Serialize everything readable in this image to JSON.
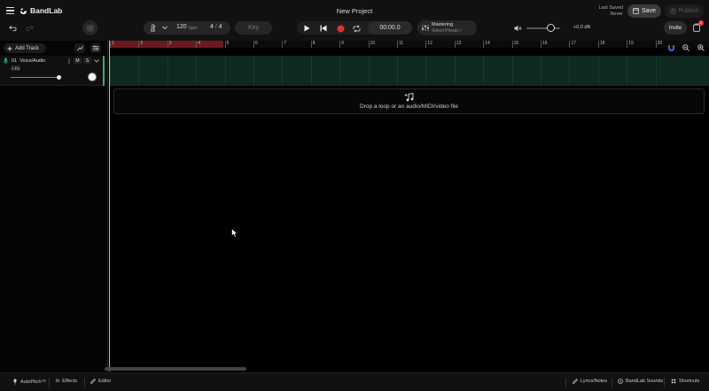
{
  "app": {
    "name": "BandLab",
    "project_title": "New Project"
  },
  "header": {
    "last_saved_label": "Last Saved",
    "last_saved_value": "Never",
    "save_label": "Save",
    "publish_label": "Publish"
  },
  "toolbar": {
    "tempo": "120",
    "tempo_unit": "bpm",
    "time_sig_top": "4",
    "time_sig_sep": "/",
    "time_sig_bottom": "4",
    "key_label": "Key",
    "time_display": "00:00.0",
    "mastering_title": "Mastering",
    "mastering_sub": "Select Preset >",
    "volume_db": "+0.0 dB",
    "volume_level": 0.72,
    "invite_label": "Invite",
    "notification_count": "2"
  },
  "tracks_panel": {
    "add_track_label": "Add Track",
    "tracks": [
      {
        "number": "01",
        "name": "Voice/Audio",
        "mute": "M",
        "solo": "S",
        "fx": "+ Fx",
        "volume": 0.85
      }
    ]
  },
  "timeline": {
    "bars": [
      "1",
      "2",
      "3",
      "4",
      "5",
      "6",
      "7",
      "8",
      "9",
      "10",
      "11",
      "12",
      "13",
      "14",
      "15",
      "16",
      "17",
      "18",
      "19",
      "20"
    ],
    "drop_text": "Drop a loop or an audio/MIDI/video file"
  },
  "bottom_bar": {
    "autopitch": "AutoPitch™",
    "effects": "Effects",
    "editor": "Editor",
    "lyrics": "Lyrics/Notes",
    "sounds": "BandLab Sounds",
    "shortcuts": "Shortcuts"
  },
  "colors": {
    "accent_green": "#2db37a",
    "record_red": "#e03030",
    "loop_region": "#6a1a1e",
    "lane_bg": "#0e2920"
  },
  "icons": [
    "menu-icon",
    "bandlab-logo-icon",
    "save-icon",
    "publish-icon",
    "undo-icon",
    "redo-icon",
    "instrument-icon",
    "metronome-icon",
    "chevron-down-icon",
    "play-icon",
    "skip-back-icon",
    "record-icon",
    "loop-icon",
    "mastering-icon",
    "speaker-icon",
    "notification-icon",
    "plus-icon",
    "automation-icon",
    "settings-icon",
    "mic-icon",
    "more-icon",
    "music-note-icon",
    "magnet-icon",
    "zoom-out-icon",
    "zoom-in-icon",
    "autopitch-icon",
    "fx-icon",
    "editor-icon",
    "lyrics-icon",
    "sounds-icon",
    "shortcuts-icon"
  ]
}
